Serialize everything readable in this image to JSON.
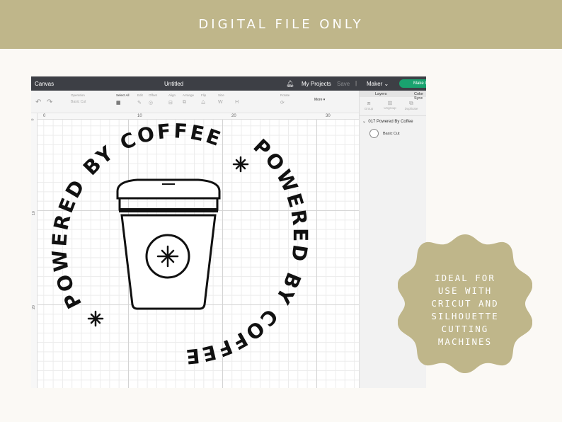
{
  "banner": {
    "text": "DIGITAL FILE ONLY"
  },
  "titlebar": {
    "app_label": "Canvas",
    "document_title": "Untitled",
    "projects_label": "My Projects",
    "save_label": "Save",
    "separator": "|",
    "machine_label": "Maker",
    "make_it_label": "Make It"
  },
  "toolbar": {
    "operation_label": "Operation",
    "operation_value": "Basic Cut",
    "select_all_label": "Select All",
    "edit_label": "Edit",
    "offset_label": "Offset",
    "align_label": "Align",
    "arrange_label": "Arrange",
    "flip_label": "Flip",
    "size_label": "Size",
    "size_w": "W",
    "size_h": "H",
    "rotate_label": "Rotate",
    "more_label": "More ▾"
  },
  "rulers": {
    "top": [
      "0",
      "10",
      "20",
      "30"
    ],
    "left": [
      "0",
      "10",
      "20"
    ]
  },
  "layers_panel": {
    "tabs": [
      "Layers",
      "Color Sync"
    ],
    "tools": [
      "Group",
      "Ungroup",
      "Duplicate"
    ],
    "group_name": "017 Powered By Coffee",
    "layer_name": "Basic Cut"
  },
  "artwork": {
    "arc_text_top": "POWERED BY COFFEE",
    "arc_text_bottom": "POWERED BY COFFEE",
    "icon": "coffee-cup-star-icon"
  },
  "badge": {
    "lines": [
      "IDEAL FOR",
      "USE WITH",
      "CRICUT AND",
      "SILHOUETTE",
      "CUTTING",
      "MACHINES"
    ],
    "color": "#bfb68a"
  },
  "colors": {
    "banner": "#bfb68a",
    "titlebar": "#3d3f45",
    "accent": "#1aa36f"
  }
}
